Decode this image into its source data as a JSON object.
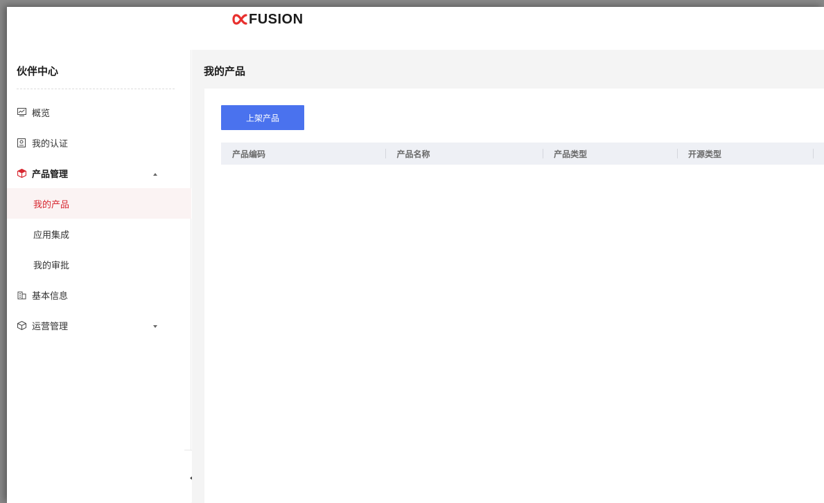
{
  "header": {
    "logo_text": "FUSION",
    "logo_mark": "∝",
    "brand_color": "#e8302e"
  },
  "sidebar": {
    "title": "伙伴中心",
    "items": [
      {
        "label": "概览",
        "icon": "chart-monitor-icon"
      },
      {
        "label": "我的认证",
        "icon": "badge-icon"
      },
      {
        "label": "产品管理",
        "icon": "box-icon",
        "expanded": true
      },
      {
        "label": "我的产品",
        "active": true
      },
      {
        "label": "应用集成"
      },
      {
        "label": "我的审批"
      },
      {
        "label": "基本信息",
        "icon": "building-icon"
      },
      {
        "label": "运营管理",
        "icon": "cube-icon",
        "expanded": false
      }
    ],
    "collapse_label": "◂"
  },
  "main": {
    "title": "我的产品",
    "add_button": "上架产品",
    "table": {
      "columns": [
        "产品编码",
        "产品名称",
        "产品类型",
        "开源类型"
      ],
      "rows": []
    }
  },
  "colors": {
    "accent": "#d7262f",
    "primary_button": "#4a72ee",
    "table_header_bg": "#eef0f5"
  }
}
